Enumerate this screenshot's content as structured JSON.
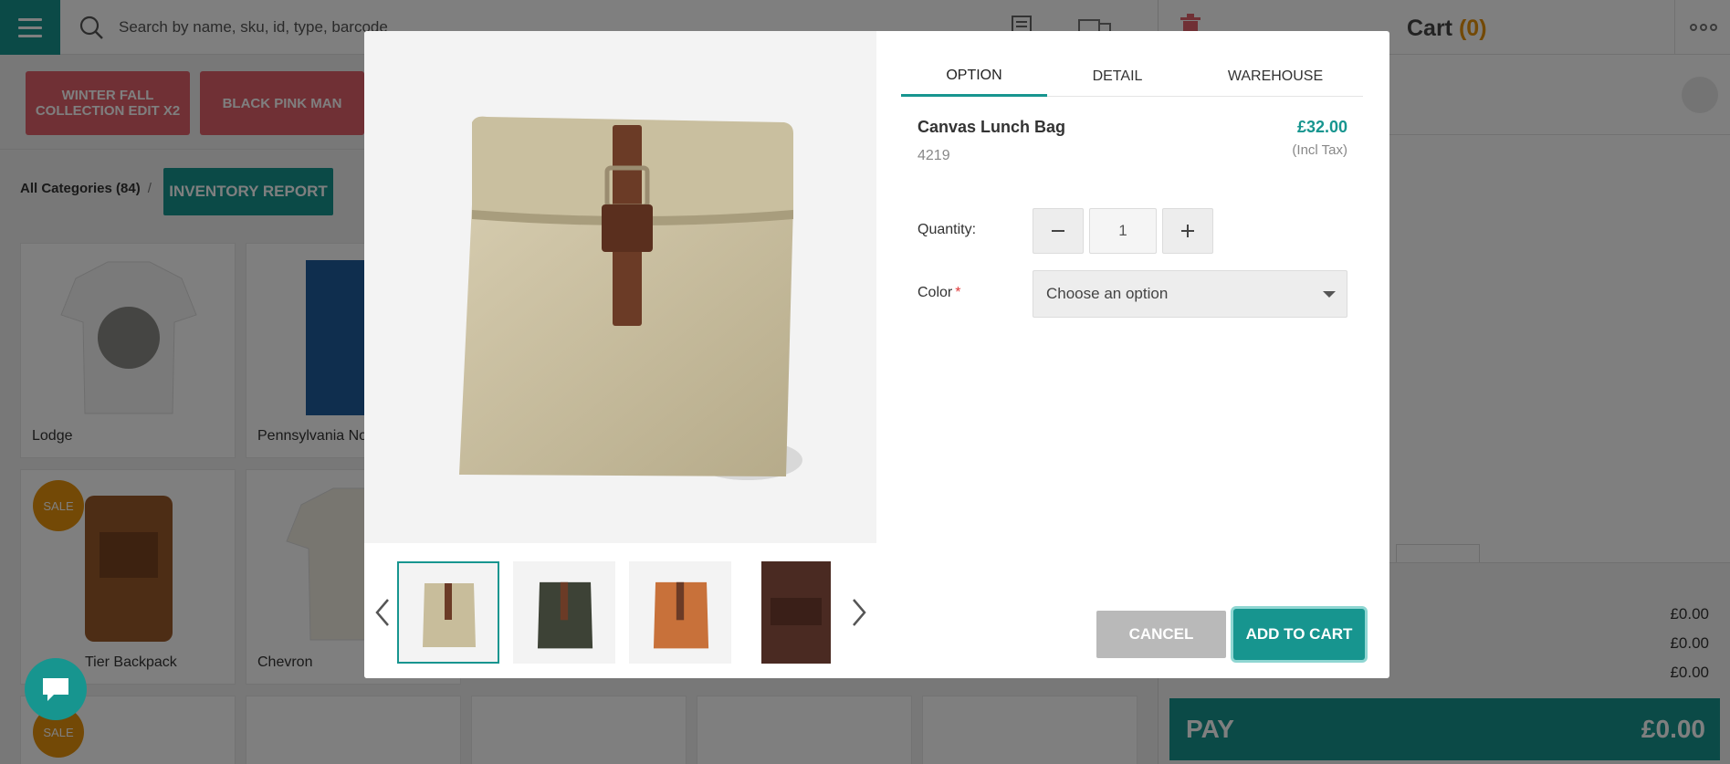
{
  "search": {
    "placeholder": "Search by name, sku, id, type, barcode"
  },
  "cart": {
    "title": "Cart",
    "count": "(0)"
  },
  "totals": {
    "lines": [
      "£0.00",
      "£0.00",
      "£0.00"
    ],
    "pay_label": "PAY",
    "pay_amount": "£0.00"
  },
  "tags": [
    {
      "label": "WINTER FALL COLLECTION EDIT X2"
    },
    {
      "label": "BLACK PINK MAN"
    }
  ],
  "breadcrumb": {
    "category": "All Categories (84)",
    "separator": "/"
  },
  "inventory_button": "INVENTORY REPORT",
  "products": [
    {
      "name": "Lodge",
      "sale": ""
    },
    {
      "name": "Pennsylvania No",
      "sale": ""
    },
    {
      "name": "Tier Backpack",
      "sale": "SALE"
    },
    {
      "name": "Chevron",
      "sale": ""
    }
  ],
  "sale_badge": "SALE",
  "modal": {
    "tabs": [
      "OPTION",
      "DETAIL",
      "WAREHOUSE"
    ],
    "active_tab": "OPTION",
    "product": {
      "name": "Canvas Lunch Bag",
      "sku": "4219",
      "price": "£32.00",
      "tax_note": "(Incl Tax)"
    },
    "quantity_label": "Quantity:",
    "quantity": "1",
    "color_label": "Color",
    "required_mark": "*",
    "color_placeholder": "Choose an option",
    "cancel_label": "CANCEL",
    "add_label": "ADD TO CART",
    "thumbnails": [
      {
        "color": "#c8bd9b",
        "selected": true
      },
      {
        "color": "#3d4236",
        "selected": false
      },
      {
        "color": "#c8713a",
        "selected": false
      },
      {
        "color": "#4a2a22",
        "selected": false
      }
    ]
  },
  "colors": {
    "accent": "#17958f",
    "orange": "#e6920d",
    "tag": "#e0606b"
  }
}
